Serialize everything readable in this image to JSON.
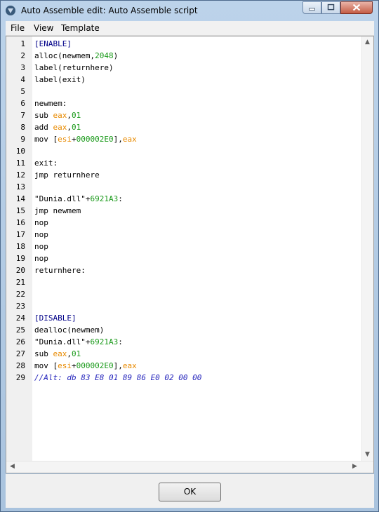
{
  "window": {
    "title": "Auto Assemble edit: Auto Assemble script",
    "icon": "cheat-engine-icon"
  },
  "menu": [
    "File",
    "View",
    "Template"
  ],
  "editor": {
    "lines": [
      [
        {
          "t": "[ENABLE]",
          "c": "sec"
        }
      ],
      [
        {
          "t": "alloc(newmem,",
          "c": "kw"
        },
        {
          "t": "2048",
          "c": "num"
        },
        {
          "t": ")",
          "c": "kw"
        }
      ],
      [
        {
          "t": "label(returnhere)",
          "c": "kw"
        }
      ],
      [
        {
          "t": "label(exit)",
          "c": "kw"
        }
      ],
      [],
      [
        {
          "t": "newmem:",
          "c": "kw"
        }
      ],
      [
        {
          "t": "sub ",
          "c": "kw"
        },
        {
          "t": "eax",
          "c": "reg"
        },
        {
          "t": ",",
          "c": "kw"
        },
        {
          "t": "01",
          "c": "num"
        }
      ],
      [
        {
          "t": "add ",
          "c": "kw"
        },
        {
          "t": "eax",
          "c": "reg"
        },
        {
          "t": ",",
          "c": "kw"
        },
        {
          "t": "01",
          "c": "num"
        }
      ],
      [
        {
          "t": "mov [",
          "c": "kw"
        },
        {
          "t": "esi",
          "c": "reg"
        },
        {
          "t": "+",
          "c": "kw"
        },
        {
          "t": "000002E0",
          "c": "num"
        },
        {
          "t": "],",
          "c": "kw"
        },
        {
          "t": "eax",
          "c": "reg"
        }
      ],
      [],
      [
        {
          "t": "exit:",
          "c": "kw"
        }
      ],
      [
        {
          "t": "jmp returnhere",
          "c": "kw"
        }
      ],
      [],
      [
        {
          "t": "\"Dunia.dll\"+",
          "c": "kw"
        },
        {
          "t": "6921A3",
          "c": "num"
        },
        {
          "t": ":",
          "c": "kw"
        }
      ],
      [
        {
          "t": "jmp newmem",
          "c": "kw"
        }
      ],
      [
        {
          "t": "nop",
          "c": "kw"
        }
      ],
      [
        {
          "t": "nop",
          "c": "kw"
        }
      ],
      [
        {
          "t": "nop",
          "c": "kw"
        }
      ],
      [
        {
          "t": "nop",
          "c": "kw"
        }
      ],
      [
        {
          "t": "returnhere:",
          "c": "kw"
        }
      ],
      [],
      [],
      [],
      [
        {
          "t": "[DISABLE]",
          "c": "sec"
        }
      ],
      [
        {
          "t": "dealloc(newmem)",
          "c": "kw"
        }
      ],
      [
        {
          "t": "\"Dunia.dll\"+",
          "c": "kw"
        },
        {
          "t": "6921A3",
          "c": "num"
        },
        {
          "t": ":",
          "c": "kw"
        }
      ],
      [
        {
          "t": "sub ",
          "c": "kw"
        },
        {
          "t": "eax",
          "c": "reg"
        },
        {
          "t": ",",
          "c": "kw"
        },
        {
          "t": "01",
          "c": "num"
        }
      ],
      [
        {
          "t": "mov [",
          "c": "kw"
        },
        {
          "t": "esi",
          "c": "reg"
        },
        {
          "t": "+",
          "c": "kw"
        },
        {
          "t": "000002E0",
          "c": "num"
        },
        {
          "t": "],",
          "c": "kw"
        },
        {
          "t": "eax",
          "c": "reg"
        }
      ],
      [
        {
          "t": "//Alt: db 83 E8 01 89 86 E0 02 00 00",
          "c": "cmt"
        }
      ]
    ]
  },
  "footer": {
    "ok_label": "OK"
  }
}
